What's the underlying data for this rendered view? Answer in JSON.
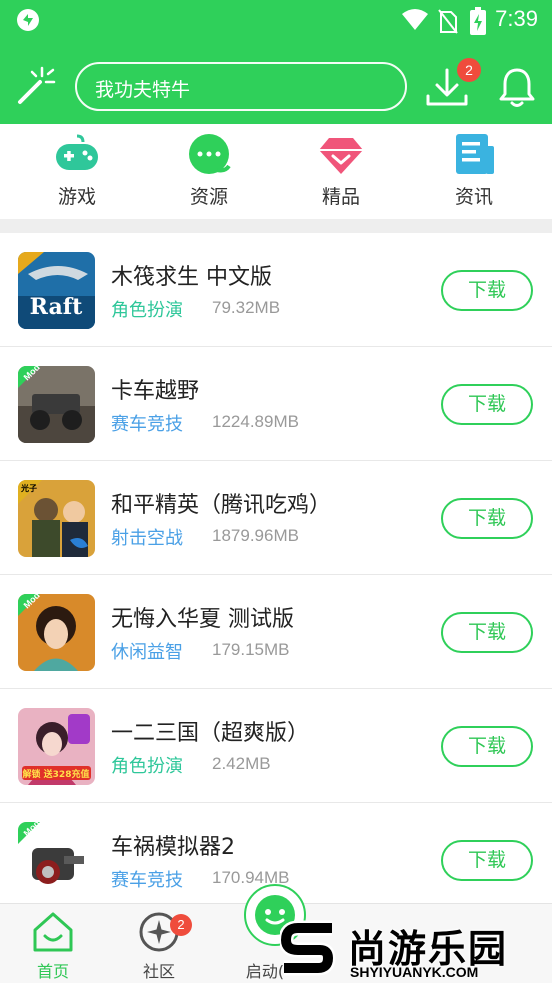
{
  "status_bar": {
    "time": "7:39",
    "icons": [
      "app-notification-icon",
      "wifi-icon",
      "no-sim-icon",
      "battery-charging-icon"
    ]
  },
  "header": {
    "search_text": "我功夫特牛",
    "download_badge": "2",
    "icons": [
      "magic-wand-icon",
      "download-icon",
      "bell-icon"
    ],
    "accent_color": "#2fd05a"
  },
  "categories": [
    {
      "label": "游戏",
      "icon": "gamepad-icon"
    },
    {
      "label": "资源",
      "icon": "chat-bubble-icon"
    },
    {
      "label": "精品",
      "icon": "diamond-icon"
    },
    {
      "label": "资讯",
      "icon": "news-icon"
    }
  ],
  "apps": [
    {
      "name": "木筏求生  中文版",
      "category": "角色扮演",
      "category_color": "#2fc79a",
      "size": "79.32MB",
      "button": "下载",
      "icon_text": "Raft"
    },
    {
      "name": "卡车越野",
      "category": "赛车竞技",
      "category_color": "#4aa0e6",
      "size": "1224.89MB",
      "button": "下载",
      "icon_text": "Mod"
    },
    {
      "name": "和平精英（腾讯吃鸡）",
      "category": "射击空战",
      "category_color": "#4aa0e6",
      "size": "1879.96MB",
      "button": "下载",
      "icon_text": "光子"
    },
    {
      "name": "无悔入华夏  测试版",
      "category": "休闲益智",
      "category_color": "#4aa0e6",
      "size": "179.15MB",
      "button": "下载",
      "icon_text": "Mod"
    },
    {
      "name": "一二三国（超爽版）",
      "category": "角色扮演",
      "category_color": "#2fc79a",
      "size": "2.42MB",
      "button": "下载",
      "icon_text": "解锁 送328充值"
    },
    {
      "name": "车祸模拟器2",
      "category": "赛车竞技",
      "category_color": "#4aa0e6",
      "size": "170.94MB",
      "button": "下载",
      "icon_text": "Mod"
    }
  ],
  "bottom_nav": {
    "items": [
      {
        "label": "首页",
        "icon": "home-icon",
        "active": true
      },
      {
        "label": "社区",
        "icon": "community-icon",
        "badge": "2"
      },
      {
        "label": "启动(",
        "icon": "launch-icon"
      }
    ]
  },
  "watermark": {
    "text": "尚游乐园",
    "url": "SHYIYUANYK.COM"
  }
}
